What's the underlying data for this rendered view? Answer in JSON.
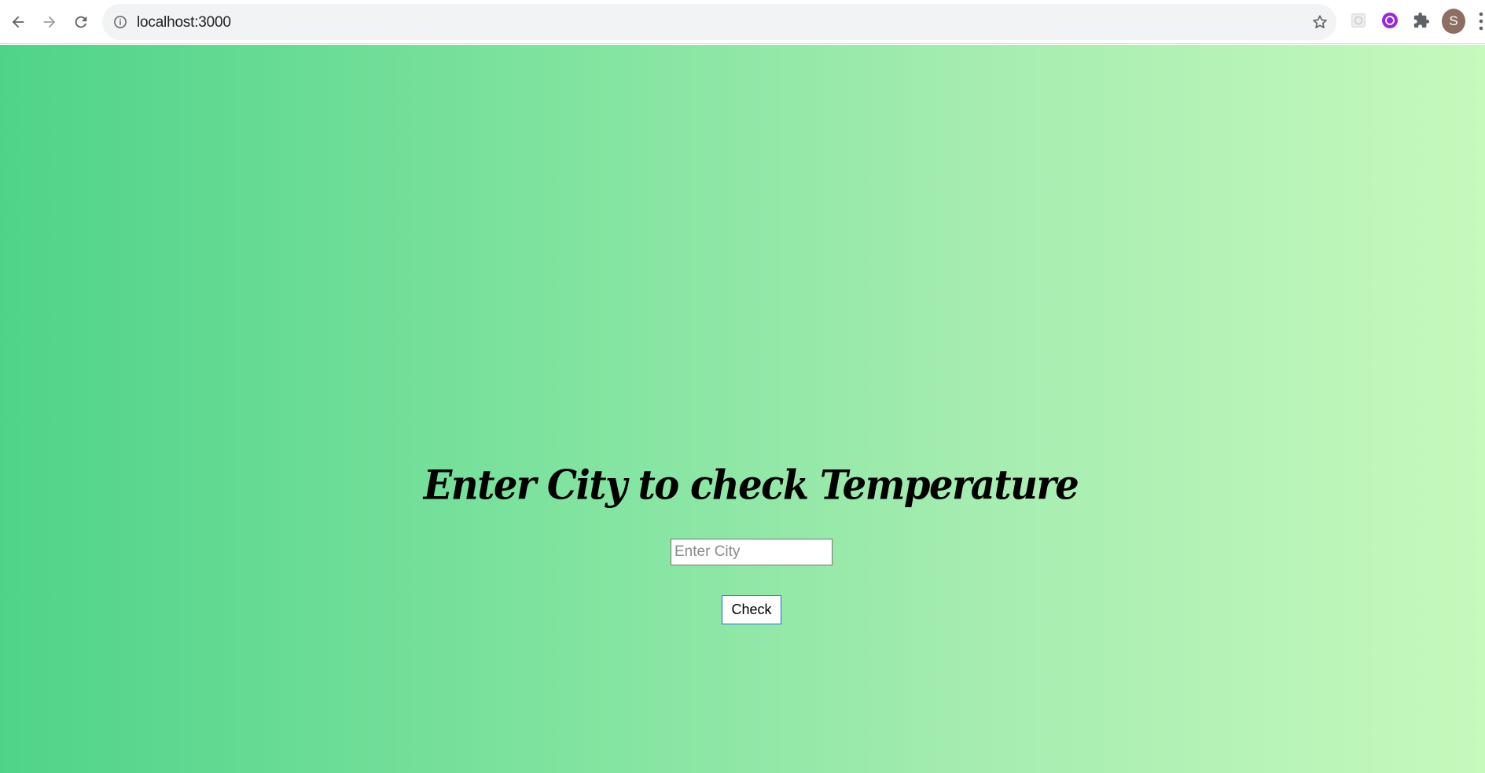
{
  "browser": {
    "url": "localhost:3000",
    "profile_initial": "S",
    "icons": [
      "back-icon",
      "forward-icon",
      "reload-icon",
      "info-icon",
      "star-icon",
      "extension-icon",
      "puzzle-icon",
      "menu-icon"
    ]
  },
  "page": {
    "heading": "Enter City to check Temperature",
    "city_input": {
      "placeholder": "Enter City",
      "value": ""
    },
    "check_button_label": "Check"
  },
  "colors": {
    "gradient_start": "#4fd38a",
    "gradient_end": "#c6f9bc",
    "button_border": "#1e70d6",
    "avatar_bg": "#8d6e63"
  }
}
